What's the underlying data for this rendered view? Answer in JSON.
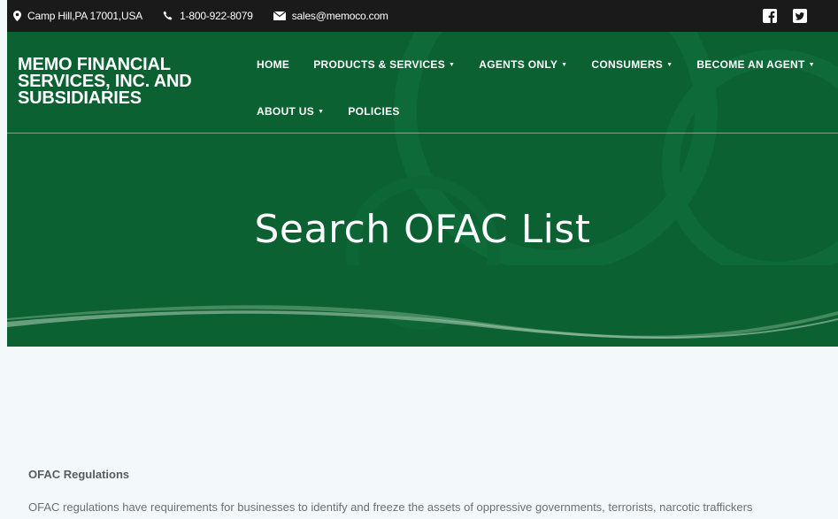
{
  "topbar": {
    "location": "Camp Hill,PA 17001,USA",
    "phone": "1-800-922-8079",
    "email": "sales@memoco.com",
    "icons": [
      "map-pin-icon",
      "phone-icon",
      "mail-icon",
      "facebook-icon",
      "twitter-icon"
    ]
  },
  "header": {
    "brand": "MEMO FINANCIAL SERVICES, INC. AND SUBSIDIARIES",
    "nav": [
      {
        "label": "HOME",
        "dropdown": false
      },
      {
        "label": "PRODUCTS & SERVICES",
        "dropdown": true
      },
      {
        "label": "AGENTS ONLY",
        "dropdown": true
      },
      {
        "label": "CONSUMERS",
        "dropdown": true
      },
      {
        "label": "BECOME AN AGENT",
        "dropdown": true
      },
      {
        "label": "ABOUT US",
        "dropdown": true
      },
      {
        "label": "POLICIES",
        "dropdown": false
      }
    ],
    "caret": "▼"
  },
  "hero": {
    "title": "Search OFAC List"
  },
  "content": {
    "heading": "OFAC Regulations",
    "paragraph": "OFAC regulations have requirements for businesses to identify and freeze the assets of oppressive governments, terrorists, narcotic traffickers"
  },
  "colors": {
    "topbar": "#1a1a1a",
    "hero": "#0b6131",
    "background": "#f3f8fa",
    "text": "#6a7275"
  }
}
